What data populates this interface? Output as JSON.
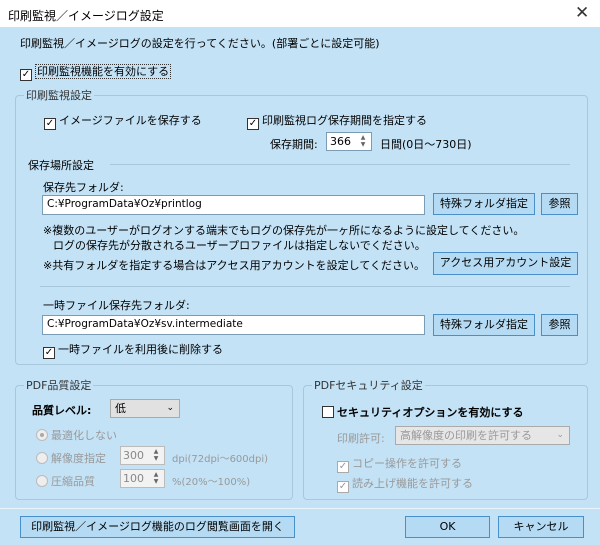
{
  "window": {
    "title": "印刷監視／イメージログ設定",
    "close_icon": "close-icon"
  },
  "intro": "印刷監視／イメージログの設定を行ってください。(部署ごとに設定可能)",
  "enable_monitor": {
    "label": "印刷監視機能を有効にする",
    "checked": true
  },
  "monitor_group": {
    "title": "印刷監視設定",
    "save_image": {
      "label": "イメージファイルを保存する",
      "checked": true
    },
    "log_period": {
      "label": "印刷監視ログ保存期間を指定する",
      "checked": true
    },
    "period_label": "保存期間:",
    "period_value": "366",
    "period_unit": "日間(0日～730日)",
    "location_title": "保存場所設定",
    "folder_label": "保存先フォルダ:",
    "folder_value": "C:¥ProgramData¥Oz¥printlog",
    "special_folder": "特殊フォルダ指定",
    "browse": "参照",
    "note1": "※複数のユーザーがログオンする端末でもログの保存先が一ヶ所になるように設定してください。",
    "note2": "ログの保存先が分散されるユーザープロファイルは指定しないでください。",
    "note3": "※共有フォルダを指定する場合はアクセス用アカウントを設定してください。",
    "access_account": "アクセス用アカウント設定",
    "temp_label": "一時ファイル保存先フォルダ:",
    "temp_value": "C:¥ProgramData¥Oz¥sv.intermediate",
    "temp_special": "特殊フォルダ指定",
    "temp_browse": "参照",
    "delete_temp": {
      "label": "一時ファイルを利用後に削除する",
      "checked": true
    }
  },
  "pdf_quality": {
    "title": "PDF品質設定",
    "level_label": "品質レベル:",
    "level_value": "低",
    "no_opt": {
      "label": "最適化しない",
      "selected": true
    },
    "resolution": {
      "label": "解像度指定",
      "value": "300",
      "unit": "dpi(72dpi～600dpi)"
    },
    "compression": {
      "label": "圧縮品質",
      "value": "100",
      "unit": "%(20%～100%)"
    }
  },
  "pdf_security": {
    "title": "PDFセキュリティ設定",
    "enable": {
      "label": "セキュリティオプションを有効にする",
      "checked": false
    },
    "print_label": "印刷許可:",
    "print_value": "高解像度の印刷を許可する",
    "copy": {
      "label": "コピー操作を許可する",
      "checked": true
    },
    "read": {
      "label": "読み上げ機能を許可する",
      "checked": true
    }
  },
  "footer": {
    "open_log": "印刷監視／イメージログ機能のログ閲覧画面を開く",
    "ok": "OK",
    "cancel": "キャンセル"
  }
}
